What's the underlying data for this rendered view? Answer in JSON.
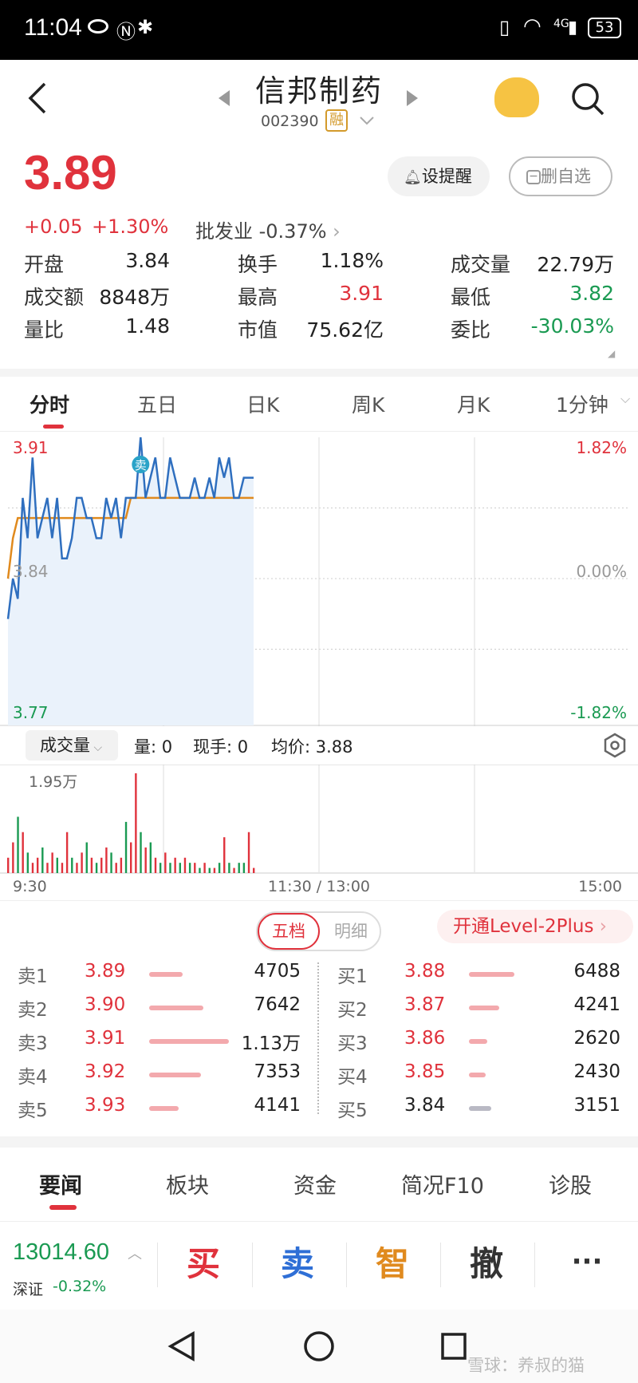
{
  "status_bar": {
    "time": "11:04",
    "battery": "53",
    "network": "4G"
  },
  "header": {
    "title": "信邦制药",
    "code": "002390",
    "badge": "融"
  },
  "quote": {
    "price": "3.89",
    "change": "+0.05",
    "change_pct": "+1.30%",
    "sector": "批发业 -0.37%",
    "alert_btn": "设提醒",
    "remove_btn": "删自选",
    "stats": [
      [
        {
          "label": "开盘",
          "value": "3.84",
          "color": "#222"
        },
        {
          "label": "换手",
          "value": "1.18%",
          "color": "#222"
        },
        {
          "label": "成交量",
          "value": "22.79万",
          "color": "#222"
        }
      ],
      [
        {
          "label": "成交额",
          "value": "8848万",
          "color": "#222"
        },
        {
          "label": "最高",
          "value": "3.91",
          "color": "#e0323c"
        },
        {
          "label": "最低",
          "value": "3.82",
          "color": "#1a9a52"
        }
      ],
      [
        {
          "label": "量比",
          "value": "1.48",
          "color": "#222"
        },
        {
          "label": "市值",
          "value": "75.62亿",
          "color": "#222"
        },
        {
          "label": "委比",
          "value": "-30.03%",
          "color": "#1a9a52"
        }
      ]
    ]
  },
  "chart_tabs": [
    "分时",
    "五日",
    "日K",
    "周K",
    "月K",
    "1分钟"
  ],
  "chart_data": {
    "type": "line",
    "price_axis": {
      "top": "3.91",
      "mid": "3.84",
      "bottom": "3.77"
    },
    "pct_axis": {
      "top": "1.82%",
      "mid": "0.00%",
      "bottom": "-1.82%"
    },
    "ylim": [
      3.77,
      3.91
    ],
    "time_labels": [
      "9:30",
      "11:30 / 13:00",
      "15:00"
    ],
    "marker": "卖",
    "price": [
      3.82,
      3.84,
      3.83,
      3.88,
      3.86,
      3.9,
      3.86,
      3.87,
      3.88,
      3.86,
      3.88,
      3.85,
      3.85,
      3.86,
      3.88,
      3.88,
      3.87,
      3.87,
      3.86,
      3.86,
      3.88,
      3.87,
      3.88,
      3.86,
      3.88,
      3.88,
      3.88,
      3.91,
      3.88,
      3.89,
      3.9,
      3.88,
      3.88,
      3.9,
      3.89,
      3.88,
      3.88,
      3.88,
      3.89,
      3.88,
      3.88,
      3.89,
      3.88,
      3.9,
      3.89,
      3.9,
      3.88,
      3.88,
      3.89,
      3.89,
      3.89
    ],
    "avg": [
      3.84,
      3.86,
      3.87,
      3.87,
      3.87,
      3.87,
      3.87,
      3.87,
      3.87,
      3.87,
      3.87,
      3.87,
      3.87,
      3.87,
      3.87,
      3.87,
      3.87,
      3.87,
      3.87,
      3.87,
      3.87,
      3.87,
      3.87,
      3.87,
      3.87,
      3.88,
      3.88,
      3.88,
      3.88,
      3.88,
      3.88,
      3.88,
      3.88,
      3.88,
      3.88,
      3.88,
      3.88,
      3.88,
      3.88,
      3.88,
      3.88,
      3.88,
      3.88,
      3.88,
      3.88,
      3.88,
      3.88,
      3.88,
      3.88,
      3.88,
      3.88
    ],
    "volume_max_label": "1.95万",
    "volume": [
      0.3,
      0.6,
      1.1,
      0.8,
      0.4,
      0.2,
      0.3,
      0.5,
      0.2,
      0.4,
      0.3,
      0.2,
      0.8,
      0.3,
      0.2,
      0.4,
      0.6,
      0.3,
      0.2,
      0.3,
      0.5,
      0.4,
      0.2,
      0.3,
      1.0,
      0.6,
      1.95,
      0.8,
      0.5,
      0.6,
      0.3,
      0.2,
      0.4,
      0.2,
      0.3,
      0.2,
      0.3,
      0.2,
      0.2,
      0.1,
      0.2,
      0.1,
      0.1,
      0.2,
      0.7,
      0.2,
      0.1,
      0.2,
      0.2,
      0.8,
      0.1
    ],
    "volume_up": [
      1,
      1,
      0,
      1,
      0,
      1,
      1,
      0,
      1,
      1,
      0,
      1,
      1,
      0,
      1,
      1,
      0,
      1,
      0,
      1,
      1,
      0,
      1,
      1,
      0,
      1,
      1,
      0,
      1,
      0,
      1,
      0,
      1,
      0,
      1,
      0,
      1,
      0,
      1,
      0,
      1,
      0,
      1,
      0,
      1,
      0,
      1,
      0,
      0,
      1,
      1
    ]
  },
  "volume_bar": {
    "label": "成交量",
    "vol": "量: 0",
    "hand": "现手: 0",
    "avg": "均价: 3.88"
  },
  "order_book": {
    "tab_active": "五档",
    "tab_inactive": "明细",
    "promo": "开通Level-2Plus",
    "asks": [
      {
        "label": "卖1",
        "price": "3.89",
        "vol": "4705",
        "bar": 0.42
      },
      {
        "label": "卖2",
        "price": "3.90",
        "vol": "7642",
        "bar": 0.68
      },
      {
        "label": "卖3",
        "price": "3.91",
        "vol": "1.13万",
        "bar": 1.0
      },
      {
        "label": "卖4",
        "price": "3.92",
        "vol": "7353",
        "bar": 0.65
      },
      {
        "label": "卖5",
        "price": "3.93",
        "vol": "4141",
        "bar": 0.37
      }
    ],
    "bids": [
      {
        "label": "买1",
        "price": "3.88",
        "vol": "6488",
        "bar": 0.57,
        "color": "#e0323c"
      },
      {
        "label": "买2",
        "price": "3.87",
        "vol": "4241",
        "bar": 0.38,
        "color": "#e0323c"
      },
      {
        "label": "买3",
        "price": "3.86",
        "vol": "2620",
        "bar": 0.23,
        "color": "#e0323c"
      },
      {
        "label": "买4",
        "price": "3.85",
        "vol": "2430",
        "bar": 0.21,
        "color": "#e0323c"
      },
      {
        "label": "买5",
        "price": "3.84",
        "vol": "3151",
        "bar": 0.28,
        "color": "#222"
      }
    ]
  },
  "bottom_tabs": [
    "要闻",
    "板块",
    "资金",
    "简况F10",
    "诊股"
  ],
  "footer": {
    "index_value": "13014.60",
    "index_name": "深证",
    "index_change": "-0.32%",
    "buy": "买",
    "sell": "卖",
    "smart": "智",
    "cancel": "撤",
    "more": "···"
  },
  "watermark": "雪球：养叔的猫"
}
